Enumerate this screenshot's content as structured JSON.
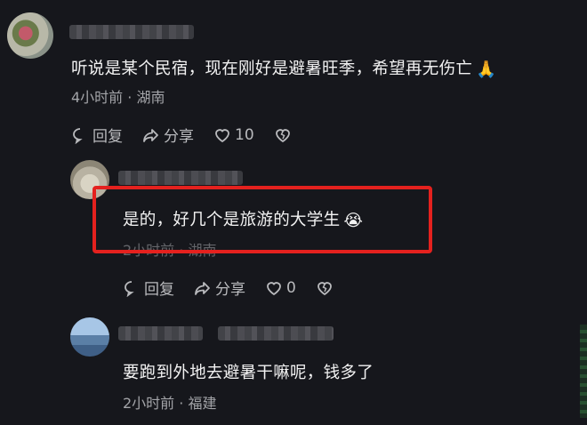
{
  "comments": [
    {
      "text": "听说是某个民宿，现在刚好是避暑旺季，希望再无伤亡",
      "time": "4小时前",
      "location": "湖南",
      "reply_label": "回复",
      "share_label": "分享",
      "likes": "10",
      "emoji": "🙏"
    },
    {
      "text": "是的，好几个是旅游的大学生",
      "time": "2小时前",
      "location": "湖南",
      "reply_label": "回复",
      "share_label": "分享",
      "likes": "0",
      "emoji": "😭"
    },
    {
      "text": "要跑到外地去避暑干嘛呢，钱多了",
      "time": "2小时前",
      "location": "福建"
    }
  ],
  "meta_separator": "·",
  "colors": {
    "highlight": "#e4211e",
    "background": "#16171c"
  }
}
